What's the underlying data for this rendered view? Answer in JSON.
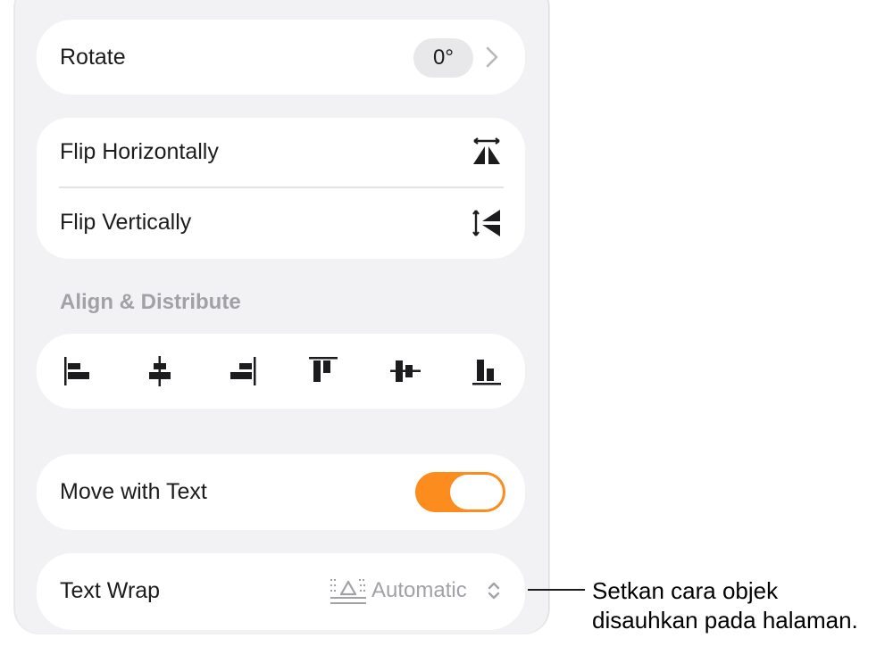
{
  "rotate": {
    "label": "Rotate",
    "value": "0°"
  },
  "flip": {
    "horizontal_label": "Flip Horizontally",
    "vertical_label": "Flip Vertically"
  },
  "align": {
    "title": "Align & Distribute",
    "buttons": [
      "align-left-icon",
      "align-center-icon",
      "align-right-icon",
      "align-top-icon",
      "align-middle-icon",
      "align-bottom-icon"
    ]
  },
  "move_with_text": {
    "label": "Move with Text",
    "on": true,
    "accent": "#fb8c1d"
  },
  "text_wrap": {
    "label": "Text Wrap",
    "value": "Automatic"
  },
  "callout": {
    "line1": "Setkan cara objek",
    "line2": "disauhkan pada halaman."
  }
}
